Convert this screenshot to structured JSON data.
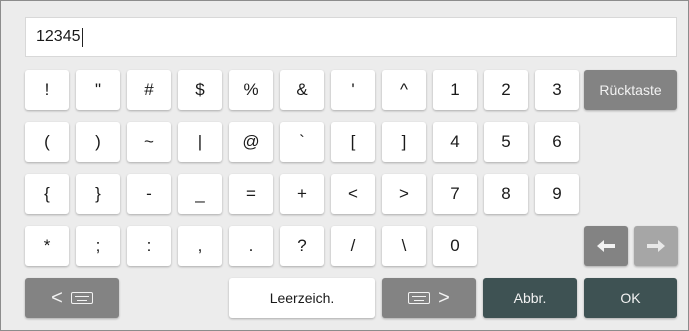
{
  "input": {
    "value": "12345"
  },
  "keys": {
    "excl": "!",
    "quote": "\"",
    "hash": "#",
    "dollar": "$",
    "percent": "%",
    "amp": "&",
    "apos": "'",
    "caret": "^",
    "k1": "1",
    "k2": "2",
    "k3": "3",
    "backspace": "Rücktaste",
    "lparen": "(",
    "rparen": ")",
    "tilde": "~",
    "pipe": "|",
    "at": "@",
    "backtick": "`",
    "lbracket": "[",
    "rbracket": "]",
    "k4": "4",
    "k5": "5",
    "k6": "6",
    "lbrace": "{",
    "rbrace": "}",
    "minus": "-",
    "underscore": "_",
    "equals": "=",
    "plus": "+",
    "lt": "<",
    "gt": ">",
    "k7": "7",
    "k8": "8",
    "k9": "9",
    "asterisk": "*",
    "semicolon": ";",
    "colon": ":",
    "comma": ",",
    "period": ".",
    "question": "?",
    "slash": "/",
    "backslash": "\\",
    "k0": "0",
    "space": "Leerzeich.",
    "cancel": "Abbr.",
    "ok": "OK",
    "prev_layout": "<",
    "next_layout": ">"
  },
  "icons": {
    "keyboard": "keyboard-icon",
    "left": "arrow-left-icon",
    "right": "arrow-right-icon"
  },
  "colors": {
    "background": "#ececec",
    "key": "#ffffff",
    "gray_key": "#838383",
    "dark_key": "#3e5253"
  }
}
